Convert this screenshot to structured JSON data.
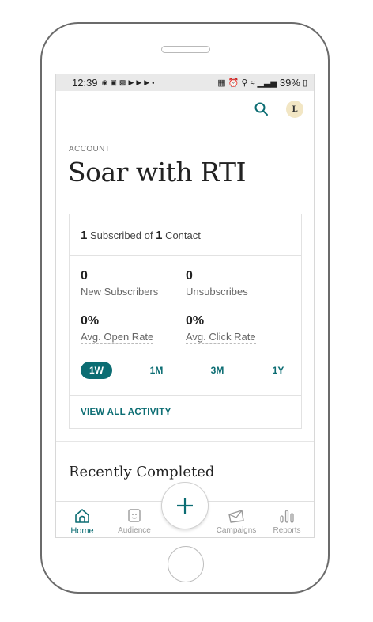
{
  "status_bar": {
    "time": "12:39",
    "battery": "39%"
  },
  "account": {
    "eyebrow": "ACCOUNT",
    "title": "Soar with RTI",
    "avatar_initial": "L"
  },
  "summary": {
    "subscribed_count": "1",
    "subscribed_text": "Subscribed of",
    "contact_count": "1",
    "contact_text": "Contact"
  },
  "stats": {
    "new_subscribers": {
      "value": "0",
      "label": "New Subscribers"
    },
    "unsubscribes": {
      "value": "0",
      "label": "Unsubscribes"
    },
    "open_rate": {
      "value": "0%",
      "label": "Avg. Open Rate"
    },
    "click_rate": {
      "value": "0%",
      "label": "Avg. Click Rate"
    }
  },
  "ranges": [
    "1W",
    "1M",
    "3M",
    "1Y"
  ],
  "active_range": "1W",
  "view_all_label": "VIEW ALL ACTIVITY",
  "recently_completed_title": "Recently Completed",
  "nav": {
    "home": "Home",
    "audience": "Audience",
    "campaigns": "Campaigns",
    "reports": "Reports"
  },
  "colors": {
    "accent": "#0c6d73",
    "avatar_bg": "#f2e6c4"
  },
  "icons": [
    "search-icon",
    "plus-icon",
    "home-icon",
    "audience-icon",
    "campaigns-icon",
    "reports-icon"
  ]
}
